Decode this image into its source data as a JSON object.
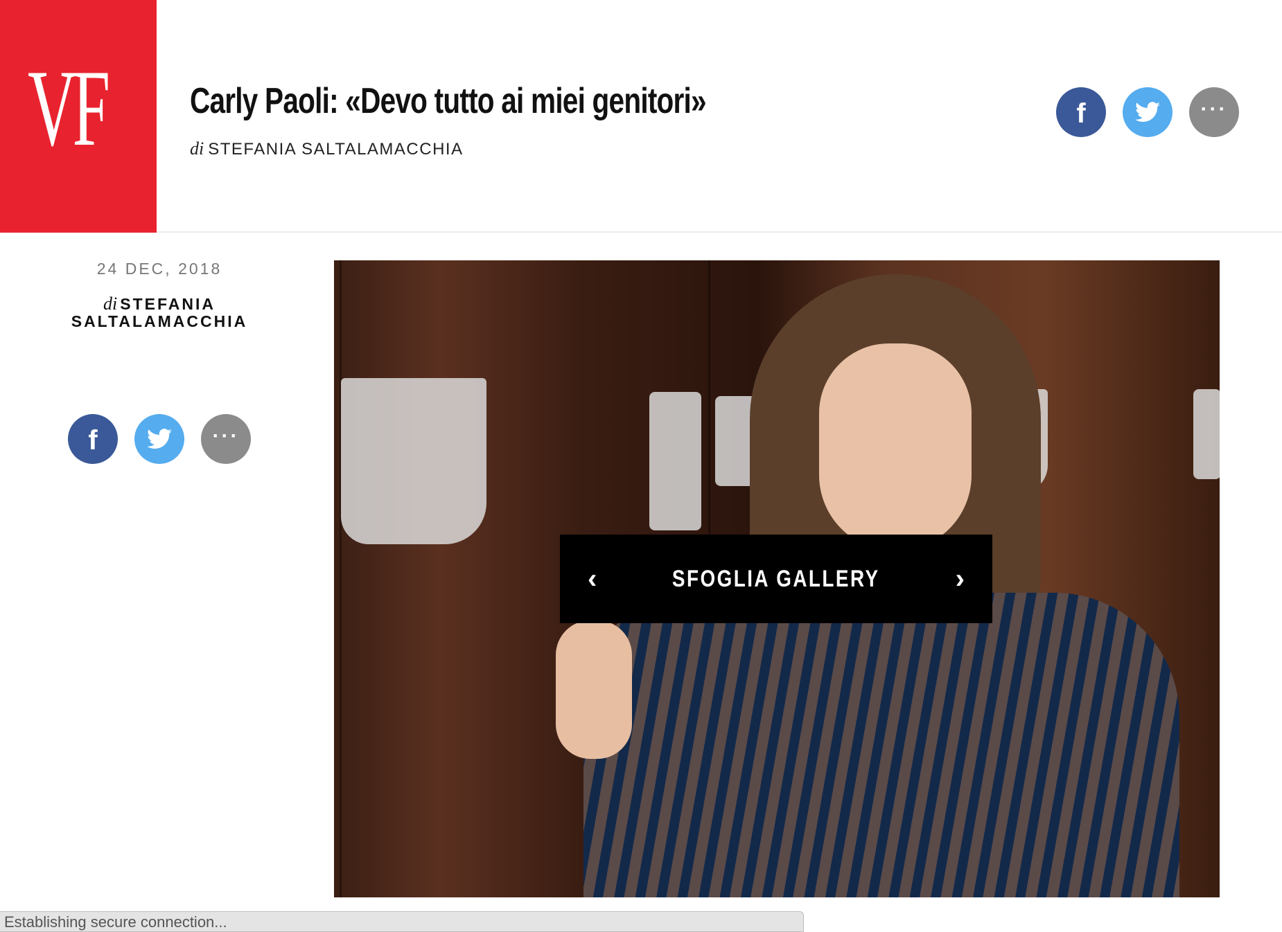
{
  "brand": {
    "logo_text": "VF",
    "color": "#e8232f"
  },
  "article": {
    "title": "Carly Paoli: «Devo tutto ai miei genitori»",
    "byline_prefix": "di",
    "byline_author": "STEFANIA SALTALAMACCHIA",
    "date": "24 DEC, 2018",
    "author_line1": "STEFANIA",
    "author_line2": "SALTALAMACCHIA"
  },
  "share": {
    "facebook_icon": "f",
    "twitter_icon": "twitter-bird",
    "more_icon": "···",
    "colors": {
      "facebook": "#3b5998",
      "twitter": "#55acee",
      "more": "#8b8b8b"
    }
  },
  "gallery": {
    "label": "SFOGLIA GALLERY",
    "prev_icon": "‹",
    "next_icon": "›"
  },
  "status_bar": {
    "text": "Establishing secure connection..."
  }
}
